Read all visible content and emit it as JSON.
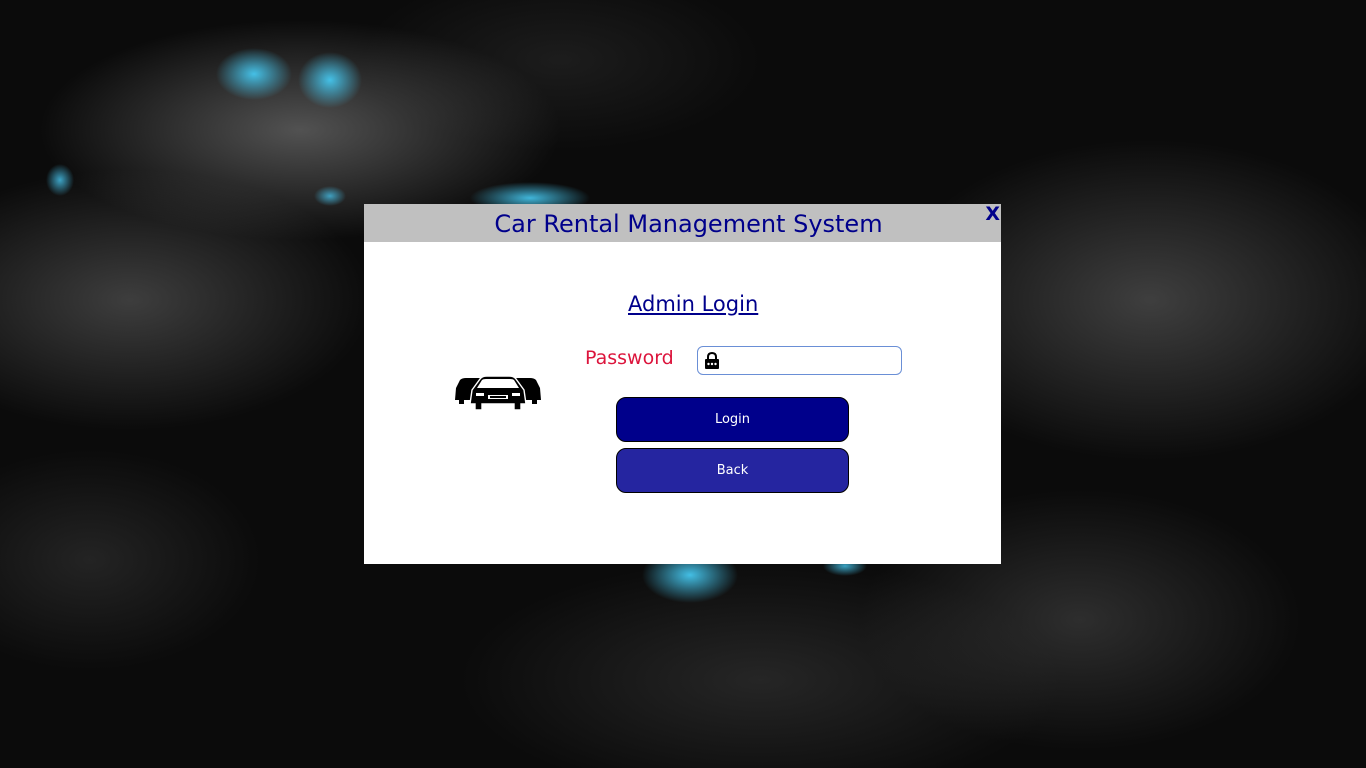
{
  "window": {
    "title": "Car Rental Management System",
    "close_label": "X"
  },
  "login": {
    "heading": "Admin Login",
    "password_label": "Password",
    "password_value": "",
    "login_button": "Login",
    "back_button": "Back"
  },
  "icons": {
    "close": "close-icon",
    "lock": "lock-icon",
    "cars": "cars-icon"
  },
  "colors": {
    "title_text": "#00008b",
    "title_bar": "#c0c0c0",
    "label_text": "#dc143c",
    "login_button": "#00008b",
    "back_button": "#2525a0",
    "input_border": "#6a8fd6"
  }
}
